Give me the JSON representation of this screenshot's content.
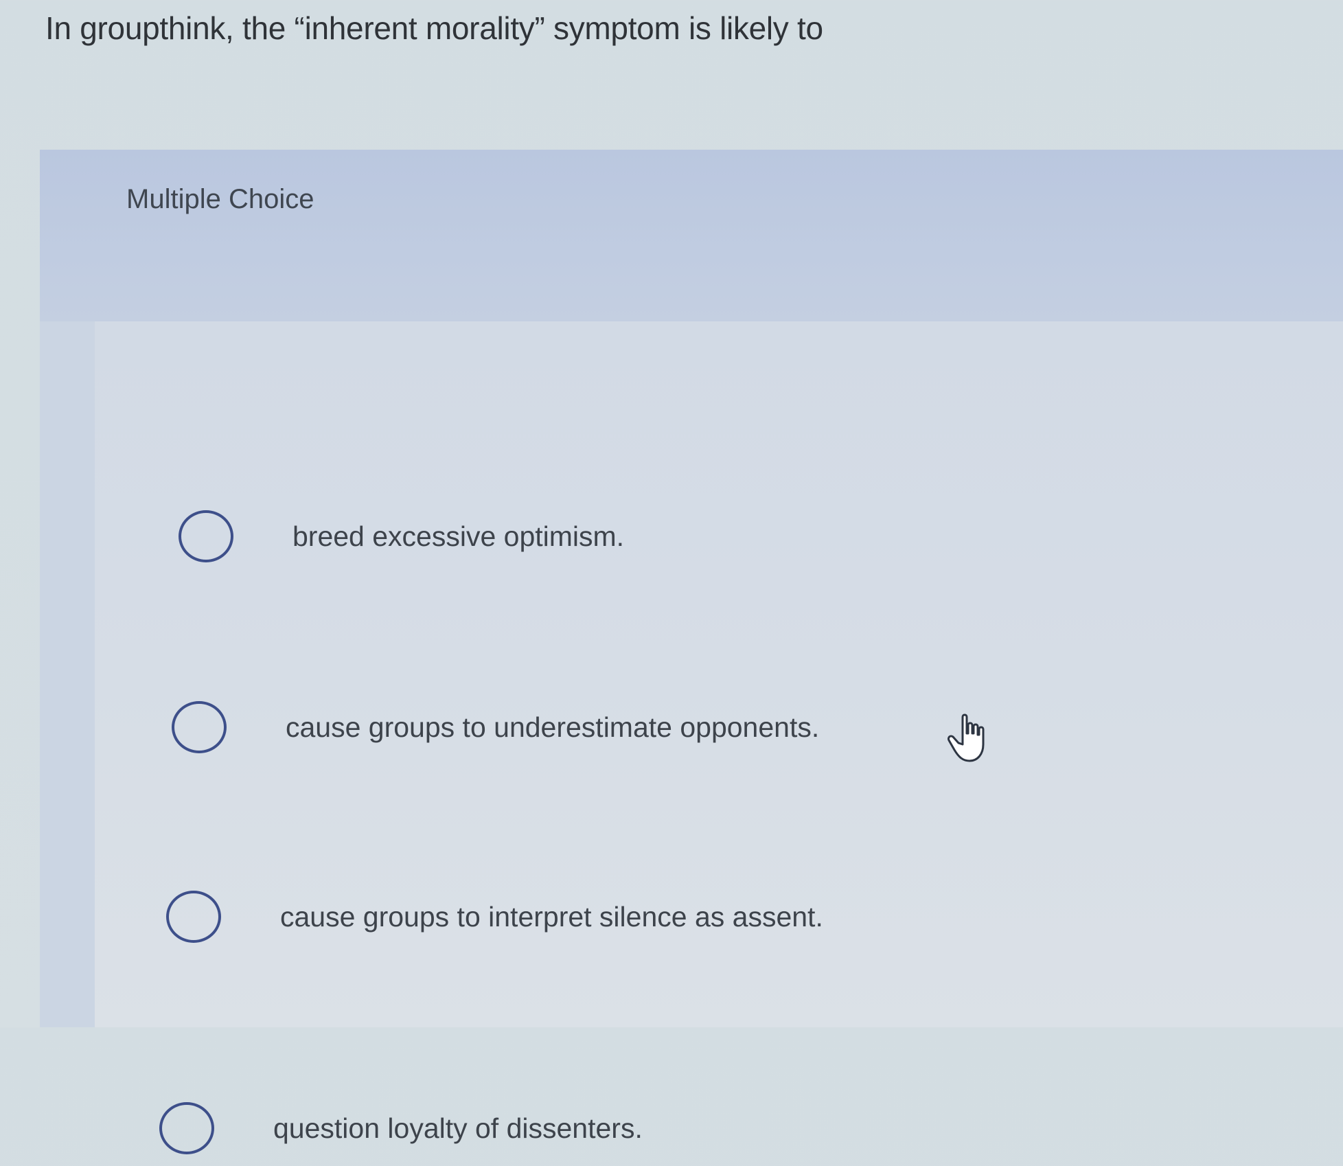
{
  "question": {
    "text": "In groupthink, the “inherent morality” symptom is likely to"
  },
  "panel": {
    "label": "Multiple Choice"
  },
  "options": [
    {
      "label": "breed excessive optimism."
    },
    {
      "label": "cause groups to underestimate opponents."
    },
    {
      "label": "cause groups to interpret silence as assent."
    },
    {
      "label": "question loyalty of dissenters."
    }
  ],
  "icons": {
    "radio": "radio-unselected-icon",
    "cursor": "hand-pointer-icon"
  },
  "colors": {
    "radio_border": "#3d4f8a",
    "panel_header": "#bac7df",
    "text": "#3d434b"
  }
}
